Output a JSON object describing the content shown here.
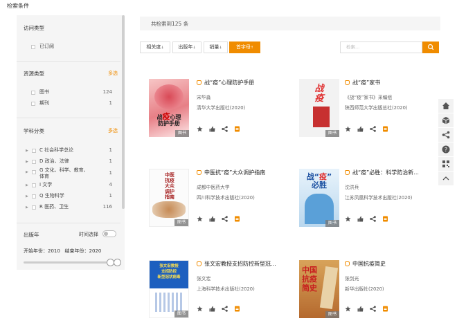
{
  "filter_title": "检索条件",
  "sidebar": {
    "access": {
      "heading": "访问类型",
      "items": [
        {
          "label": "已订阅"
        }
      ]
    },
    "resource": {
      "heading": "资源类型",
      "more": "多选",
      "items": [
        {
          "label": "图书",
          "count": "124"
        },
        {
          "label": "期刊",
          "count": "1"
        }
      ]
    },
    "subject": {
      "heading": "学科分类",
      "more": "多选",
      "items": [
        {
          "label": "C 社会科学总论",
          "count": "1"
        },
        {
          "label": "D 政治、法律",
          "count": "1"
        },
        {
          "label": "G 文化、科学、教育、体育",
          "count": "1"
        },
        {
          "label": "I 文学",
          "count": "4"
        },
        {
          "label": "Q 生物科学",
          "count": "1"
        },
        {
          "label": "R 医药、卫生",
          "count": "116"
        }
      ]
    },
    "year": {
      "heading": "出版年",
      "time_select": "时间选择",
      "start": "开始年份：2010",
      "end": "结束年份：2020"
    }
  },
  "results": {
    "summary": "共检索到125 条"
  },
  "sort": [
    {
      "label": "相关度",
      "arrow": "↓"
    },
    {
      "label": "出版年",
      "arrow": "↓"
    },
    {
      "label": "销量",
      "arrow": "↓"
    },
    {
      "label": "首字母",
      "arrow": "↑"
    }
  ],
  "search": {
    "placeholder": "检索..."
  },
  "cover_tag": "图书",
  "books": [
    {
      "title": "战“疫”心理防护手册",
      "author": "宋华淼",
      "publisher": "清华大学出版社(2020)",
      "cover_text": "战疫心理防护手册"
    },
    {
      "title": "战“疫”家书",
      "author": "《战“疫”家书》采编组",
      "publisher": "陕西师范大学出版总社(2020)",
      "cover_text": "战疫家书"
    },
    {
      "title": "中医抗“疫”大众调护指南",
      "author": "成都中医药大学",
      "publisher": "四川科学技术出版社(2020)",
      "cover_text": "中医抗疫大众调护指南"
    },
    {
      "title": "战“疫”必胜：科学防治新...",
      "author": "沈洪兵",
      "publisher": "江苏凤凰科学技术出版社(2020)",
      "cover_text": "战疫必胜"
    },
    {
      "title": "张文宏教授支招防控新型冠...",
      "author": "张文宏",
      "publisher": "上海科学技术出版社(2020)",
      "cover_text": "张文宏教授支招防控新型冠状病毒"
    },
    {
      "title": "中国抗疫简史",
      "author": "张剑光",
      "publisher": "新华出版社(2020)",
      "cover_text": "中国抗疫简史"
    }
  ],
  "colors": {
    "accent": "#f08c00",
    "panel": "#f5f5f5"
  }
}
